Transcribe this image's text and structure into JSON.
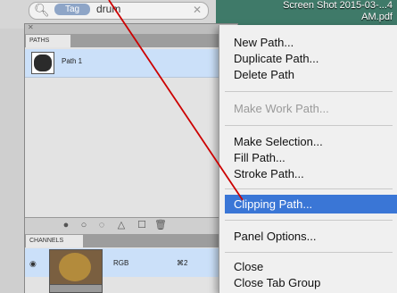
{
  "search": {
    "token": "Tag",
    "text": "drum"
  },
  "desktop": {
    "file_label": "Screen Shot 2015-03-...4 AM.pdf"
  },
  "paths_panel": {
    "tab_label": "PATHS",
    "items": [
      {
        "label": "Path 1"
      }
    ],
    "footer_icons": [
      "fill-path-icon",
      "stroke-path-icon",
      "load-selection-icon",
      "work-path-icon",
      "new-path-icon",
      "delete-path-icon"
    ]
  },
  "channels_panel": {
    "tab_label": "CHANNELS",
    "items": [
      {
        "name": "RGB",
        "shortcut": "⌘2"
      }
    ]
  },
  "context_menu": {
    "items": [
      {
        "label": "New Path..."
      },
      {
        "label": "Duplicate Path..."
      },
      {
        "label": "Delete Path"
      },
      {
        "label": "Make Work Path..."
      },
      {
        "label": "Make Selection..."
      },
      {
        "label": "Fill Path..."
      },
      {
        "label": "Stroke Path..."
      },
      {
        "label": "Clipping Path..."
      },
      {
        "label": "Panel Options..."
      },
      {
        "label": "Close"
      },
      {
        "label": "Close Tab Group"
      }
    ],
    "disabled_item": "Make Work Path...",
    "highlighted_item": "Clipping Path..."
  },
  "colors": {
    "highlight": "#3a76d6",
    "selection_row": "#cbe0f9",
    "annotation": "#cc0000"
  }
}
